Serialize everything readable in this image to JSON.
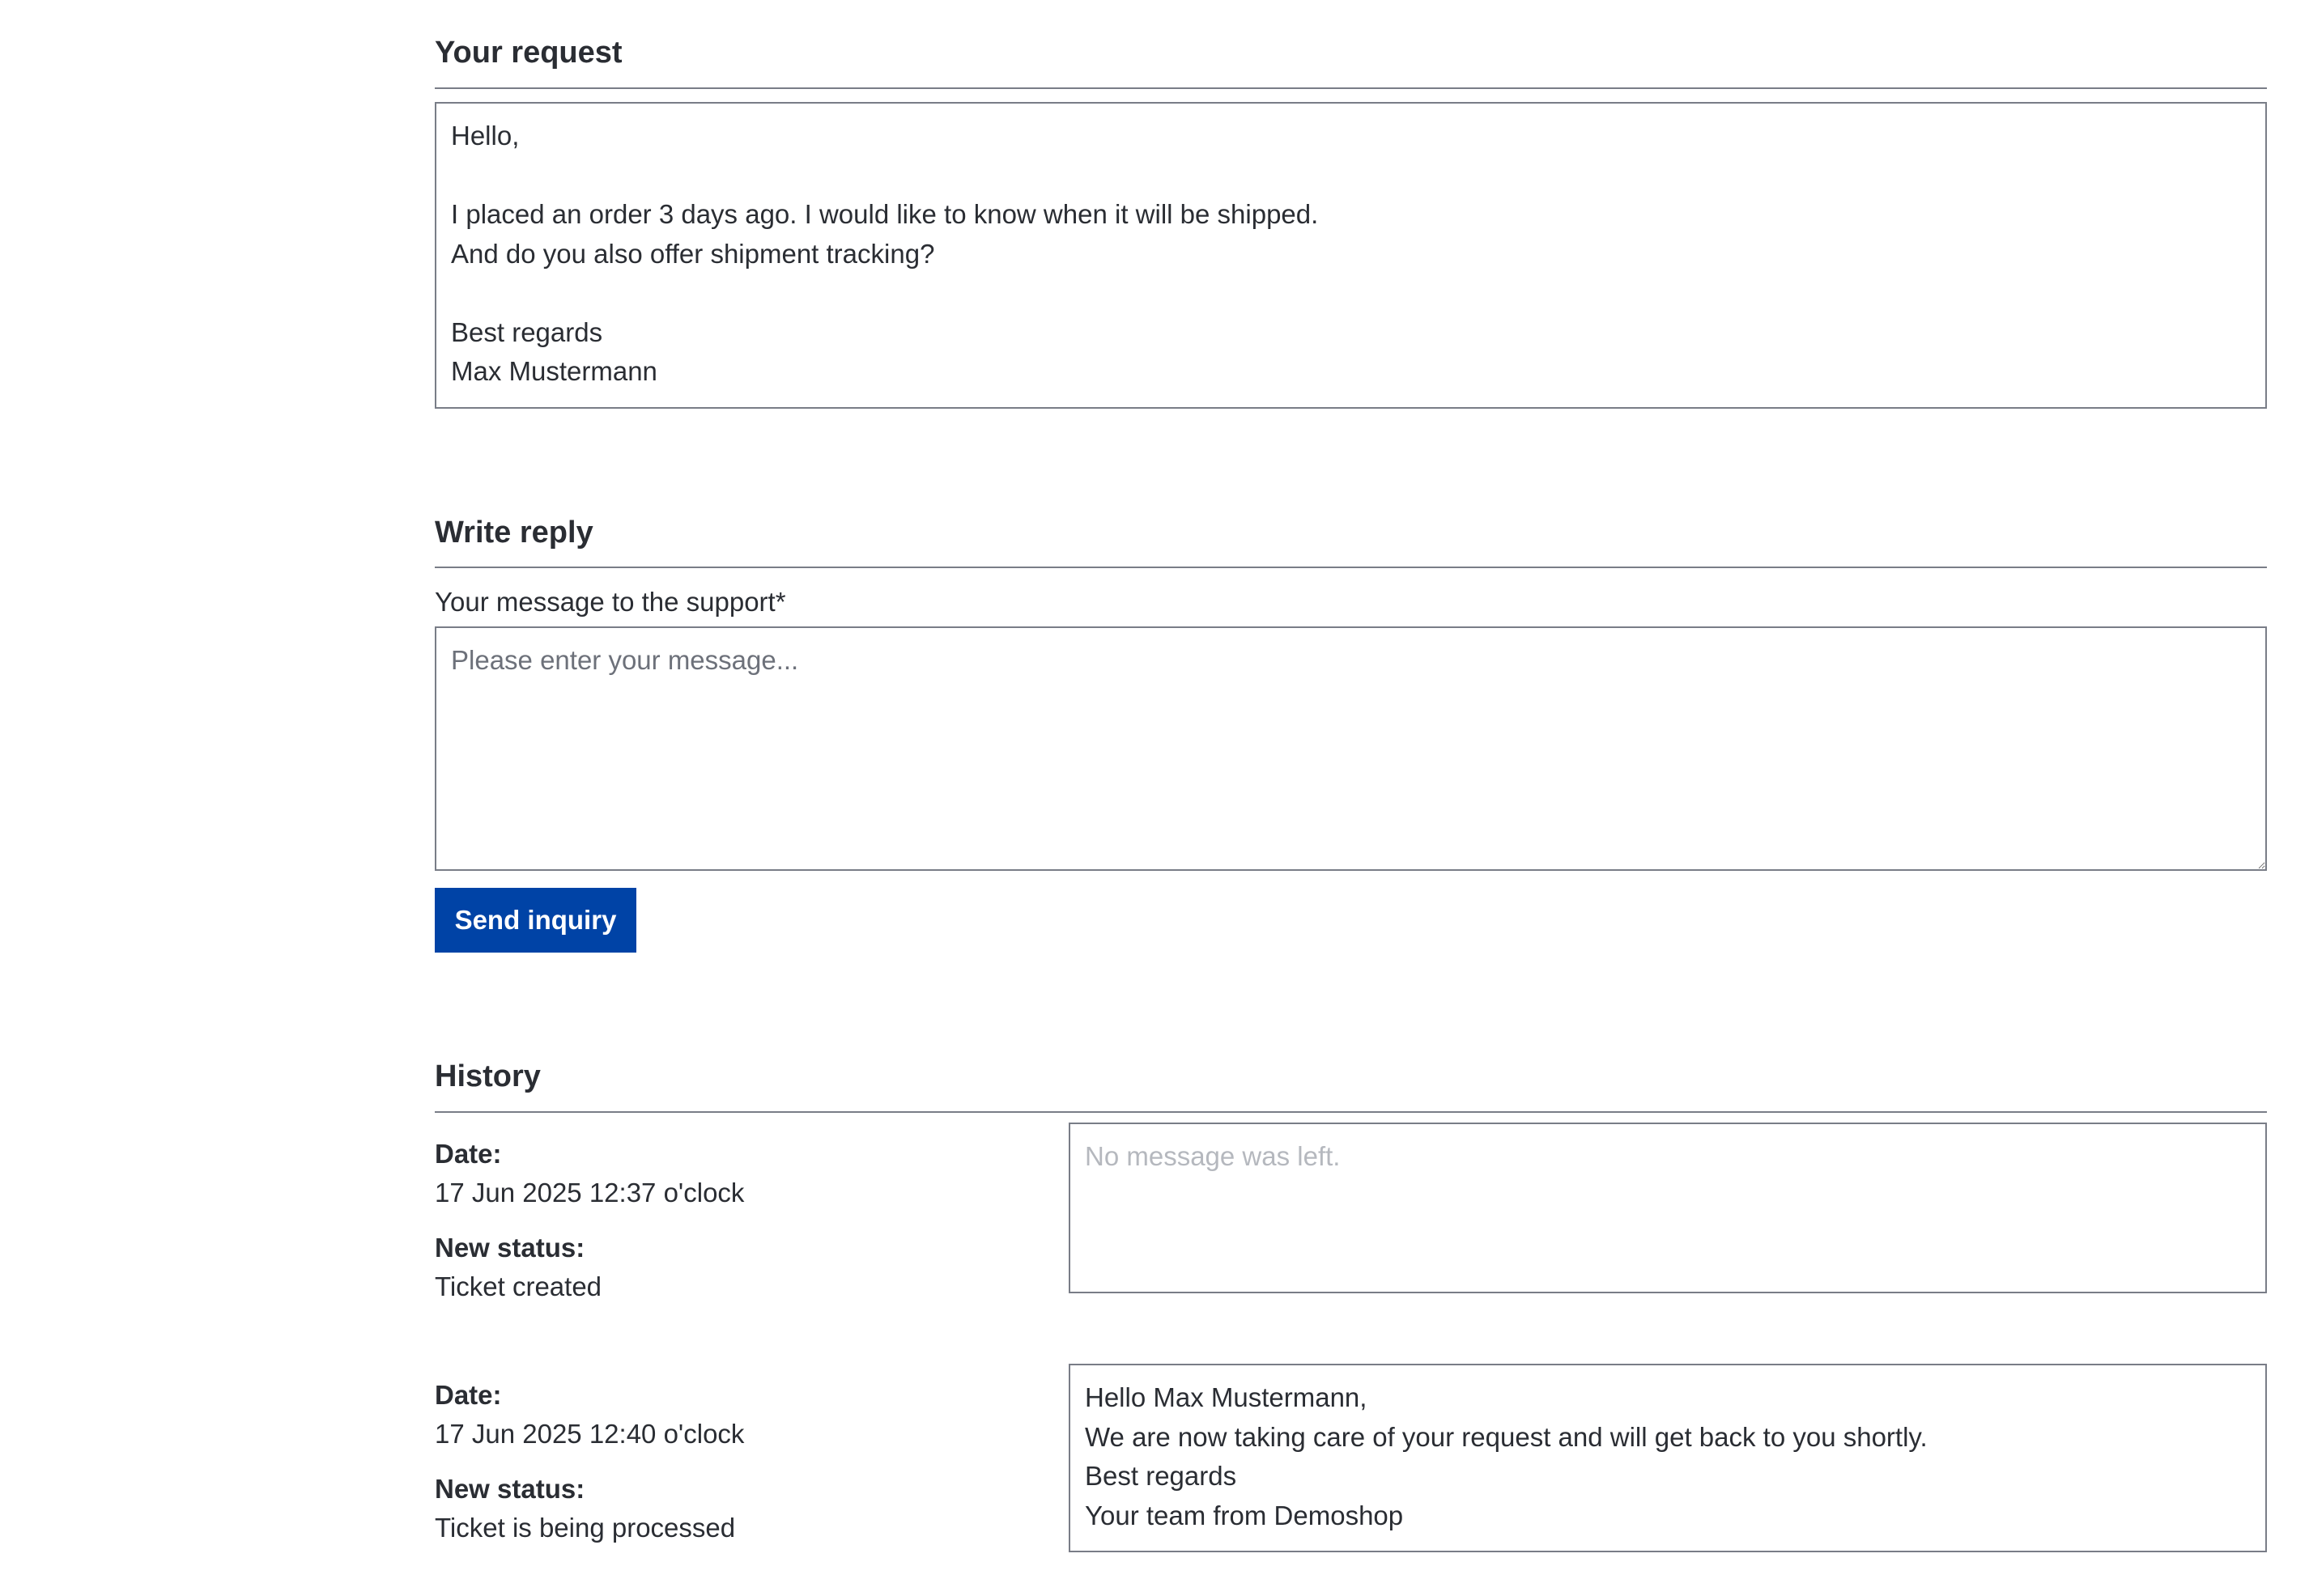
{
  "request": {
    "title": "Your request",
    "message_lines": [
      "Hello,",
      "",
      "I placed an order 3 days ago. I would like to know when it will be shipped.",
      "And do you also offer shipment tracking?",
      "",
      "Best regards",
      "Max Mustermann"
    ]
  },
  "reply": {
    "title": "Write reply",
    "field_label": "Your message to the support*",
    "placeholder": "Please enter your message...",
    "value": "",
    "submit_label": "Send inquiry"
  },
  "history": {
    "title": "History",
    "date_label": "Date:",
    "status_label": "New status:",
    "entries": [
      {
        "date": "17 Jun 2025 12:37 o'clock",
        "status": "Ticket created",
        "message_lines": [
          "No message was left."
        ]
      },
      {
        "date": "17 Jun 2025 12:40 o'clock",
        "status": "Ticket is being processed",
        "message_lines": [
          "Hello Max Mustermann,",
          "We are now taking care of your request and will get back to you shortly.",
          "Best regards",
          "Your team from Demoshop"
        ]
      }
    ]
  },
  "colors": {
    "primary_button": "#0043a6",
    "text": "#2a2d33",
    "border": "#797d87",
    "muted_text": "#b5b8be"
  }
}
